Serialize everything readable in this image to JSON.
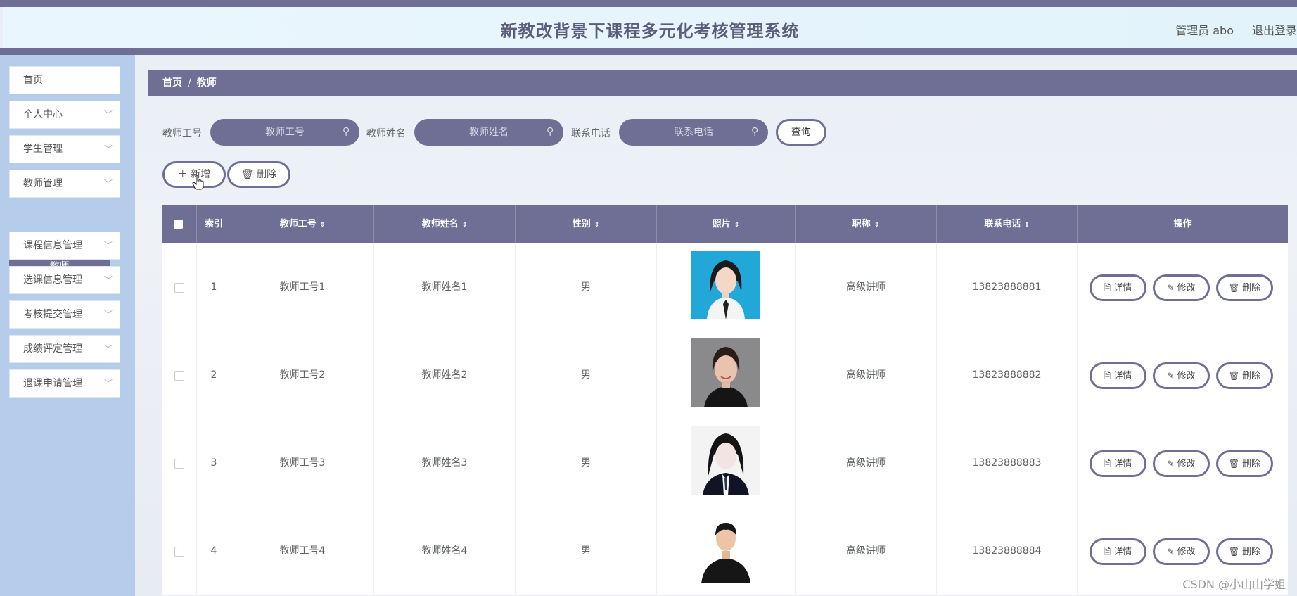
{
  "header": {
    "title": "新教改背景下课程多元化考核管理系统",
    "user": "管理员 abo",
    "logout": "退出登录"
  },
  "sidebar": {
    "items": [
      {
        "label": "首页"
      },
      {
        "label": "个人中心"
      },
      {
        "label": "学生管理"
      },
      {
        "label": "教师管理"
      },
      {
        "label": "课程信息管理"
      },
      {
        "label": "选课信息管理"
      },
      {
        "label": "考核提交管理"
      },
      {
        "label": "成绩评定管理"
      },
      {
        "label": "退课申请管理"
      }
    ],
    "submenu": {
      "label": "教师"
    }
  },
  "breadcrumb": {
    "home": "首页",
    "sep": "/",
    "current": "教师"
  },
  "search": {
    "fields": [
      {
        "label": "教师工号",
        "placeholder": "教师工号"
      },
      {
        "label": "教师姓名",
        "placeholder": "教师姓名"
      },
      {
        "label": "联系电话",
        "placeholder": "联系电话"
      }
    ],
    "query": "查询"
  },
  "toolbar": {
    "add": "新增",
    "delete": "删除"
  },
  "table": {
    "columns": [
      "索引",
      "教师工号",
      "教师姓名",
      "性别",
      "照片",
      "职称",
      "联系电话",
      "操作"
    ],
    "rows": [
      {
        "index": "1",
        "id": "教师工号1",
        "name": "教师姓名1",
        "gender": "男",
        "title": "高级讲师",
        "phone": "13823888881"
      },
      {
        "index": "2",
        "id": "教师工号2",
        "name": "教师姓名2",
        "gender": "男",
        "title": "高级讲师",
        "phone": "13823888882"
      },
      {
        "index": "3",
        "id": "教师工号3",
        "name": "教师姓名3",
        "gender": "男",
        "title": "高级讲师",
        "phone": "13823888883"
      },
      {
        "index": "4",
        "id": "教师工号4",
        "name": "教师姓名4",
        "gender": "男",
        "title": "高级讲师",
        "phone": "13823888884"
      }
    ],
    "ops": {
      "detail": "详情",
      "edit": "修改",
      "delete": "删除"
    }
  },
  "watermark": "CSDN @小山山学姐",
  "colors": {
    "accent": "#6f6f95",
    "sidebar": "#b5cdea"
  }
}
